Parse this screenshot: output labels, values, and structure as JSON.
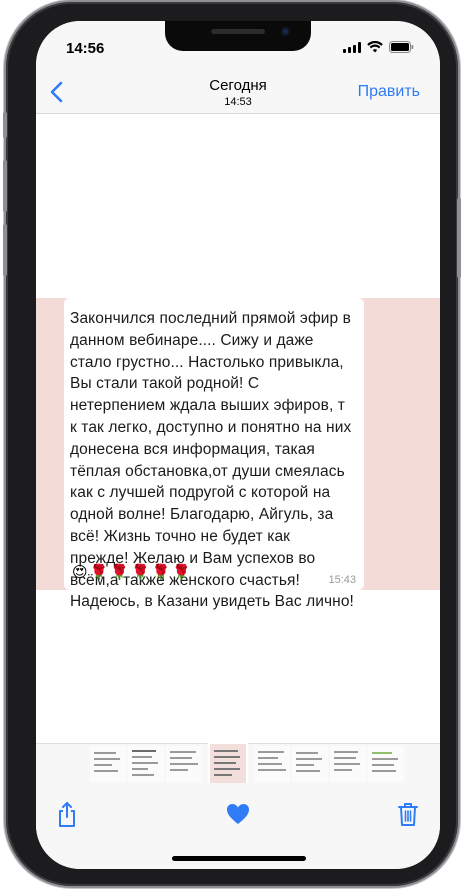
{
  "status_bar": {
    "time": "14:56"
  },
  "nav": {
    "title": "Сегодня",
    "subtitle": "14:53",
    "edit_label": "Править"
  },
  "message": {
    "lines": [
      "Закончился последний прямой эфир в",
      "данном вебинаре.... Сижу и даже",
      "стало грустно... Настолько привыкла,",
      "Вы стали такой родной! С",
      "нетерпением ждала выших эфиров, т",
      "к так легко, доступно и понятно на них",
      "донесена вся информация, такая",
      "тёплая обстановка,от души смеялась",
      "как с лучшей подругой с которой на",
      "одной волне! Благодарю, Айгуль, за",
      "всё! Жизнь точно не будет как",
      "прежде! Желаю и Вам успехов во",
      "всём,а также женского счастья!",
      "Надеюсь, в Казани увидеть Вас лично!"
    ],
    "emoji": "😍🌹🌹🌹🌹🌹",
    "time": "15:43"
  },
  "colors": {
    "accent": "#2f7cf6",
    "photo_background": "#f3dbd8",
    "bar_background": "#f7f7f7"
  },
  "toolbar": {
    "share_icon": "share-icon",
    "like_icon": "heart-icon",
    "delete_icon": "trash-icon"
  }
}
